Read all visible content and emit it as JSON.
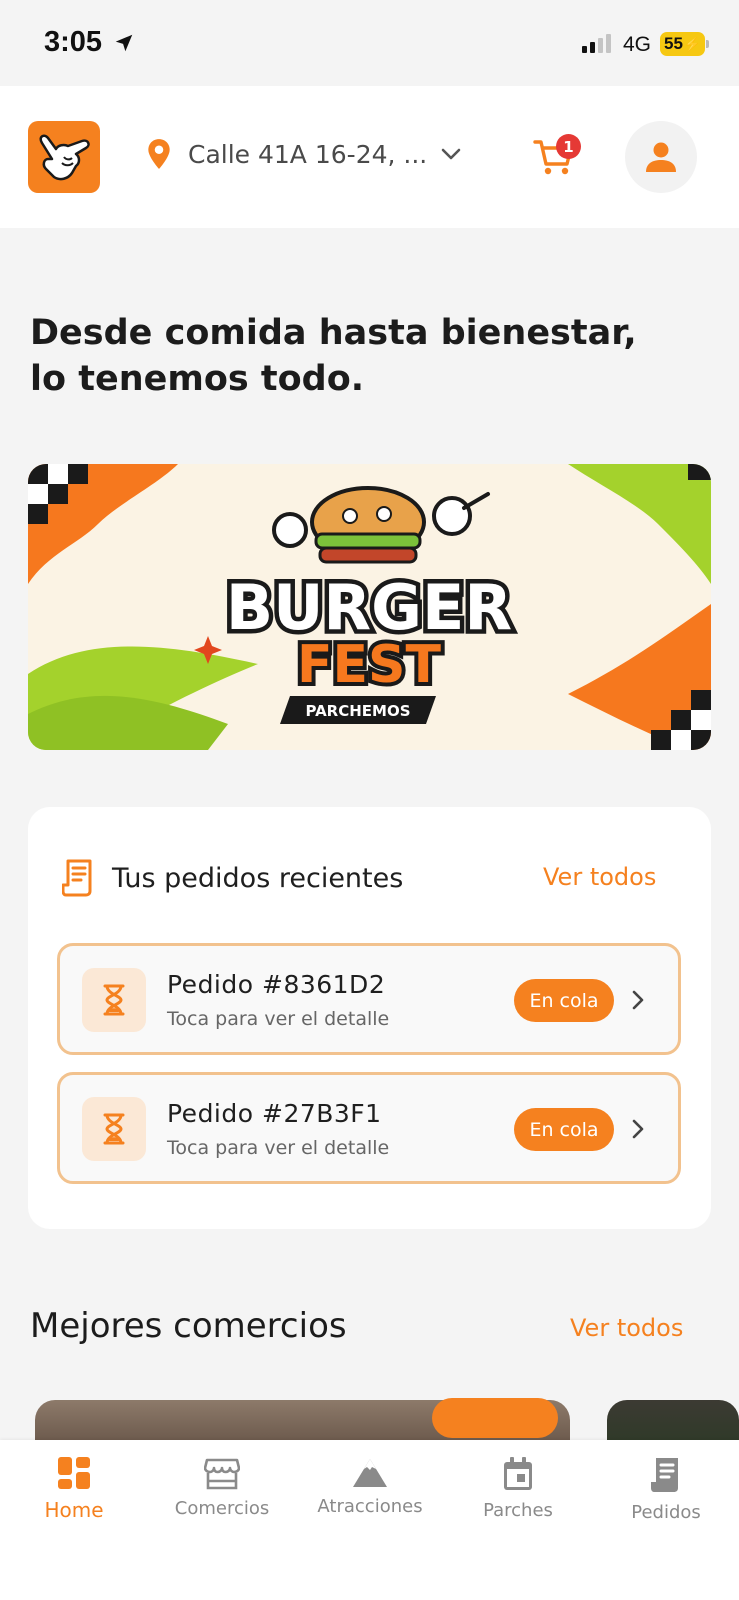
{
  "status_bar": {
    "time": "3:05",
    "network": "4G",
    "battery": "55"
  },
  "header": {
    "address": "Calle 41A 16-24, ...",
    "cart_count": "1"
  },
  "headline": {
    "line1": "Desde comida hasta bienestar,",
    "line2": "lo tenemos todo."
  },
  "banner": {
    "word1": "BURGER",
    "word2": "FEST",
    "tag": "PARCHEMOS"
  },
  "orders": {
    "title": "Tus pedidos recientes",
    "see_all": "Ver todos",
    "items": [
      {
        "id": "Pedido #8361D2",
        "subtitle": "Toca para ver el detalle",
        "status": "En cola"
      },
      {
        "id": "Pedido #27B3F1",
        "subtitle": "Toca para ver el detalle",
        "status": "En cola"
      }
    ]
  },
  "best_shops": {
    "title": "Mejores comercios",
    "see_all": "Ver todos"
  },
  "nav": [
    {
      "label": "Home",
      "icon": "grid-icon"
    },
    {
      "label": "Comercios",
      "icon": "store-icon"
    },
    {
      "label": "Atracciones",
      "icon": "mountain-icon"
    },
    {
      "label": "Parches",
      "icon": "calendar-icon"
    },
    {
      "label": "Pedidos",
      "icon": "receipt-icon"
    }
  ],
  "colors": {
    "accent": "#f5811f",
    "badge": "#e53935",
    "order_border": "#f2c28e"
  }
}
